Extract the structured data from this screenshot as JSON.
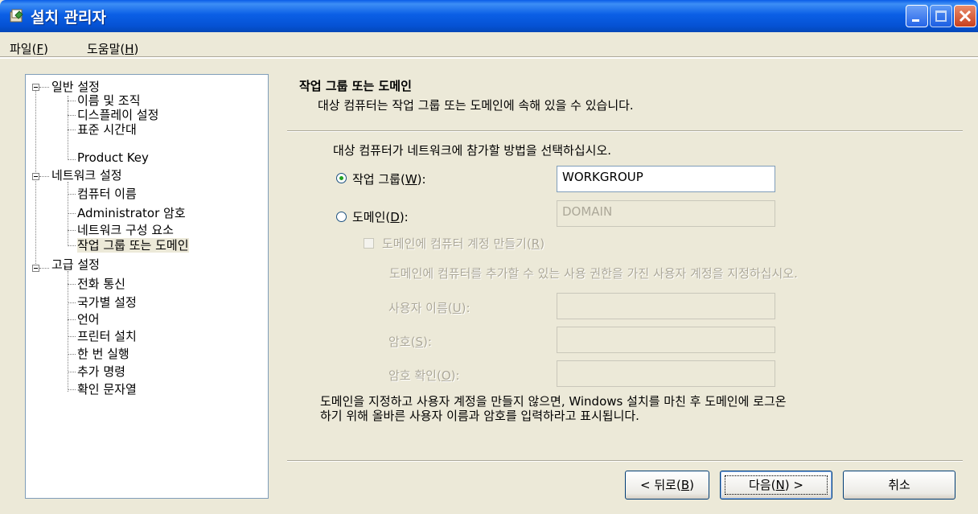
{
  "window": {
    "title": "설치 관리자",
    "icon": "setup-manager-icon"
  },
  "menu": [
    {
      "label": "파일(",
      "key": "F",
      "suffix": ")"
    },
    {
      "label": "도움말(",
      "key": "H",
      "suffix": ")"
    }
  ],
  "tree": {
    "groups": [
      {
        "label": "일반 설정",
        "children": [
          "이름 및 조직",
          "디스플레이 설정",
          "표준 시간대",
          "Product Key"
        ]
      },
      {
        "label": "네트워크 설정",
        "children": [
          "컴퓨터 이름",
          "Administrator 암호",
          "네트워크 구성 요소",
          "작업 그룹 또는 도메인"
        ]
      },
      {
        "label": "고급 설정",
        "children": [
          "전화 통신",
          "국가별 설정",
          "언어",
          "프린터 설치",
          "한 번 실행",
          "추가 명령",
          "확인 문자열"
        ]
      }
    ],
    "selected": "작업 그룹 또는 도메인"
  },
  "page": {
    "heading": "작업 그룹 또는 도메인",
    "subheading": "대상 컴퓨터는 작업 그룹 또는 도메인에 속해 있을 수 있습니다.",
    "prompt": "대상 컴퓨터가 네트워크에 참가할 방법을 선택하십시오.",
    "workgroup": {
      "label": "작업 그룹(",
      "key": "W",
      "suffix": "):",
      "value": "WORKGROUP",
      "selected": true
    },
    "domain": {
      "label": "도메인(",
      "key": "D",
      "suffix": "):",
      "value": "DOMAIN",
      "selected": false
    },
    "create_account": {
      "label": "도메인에 컴퓨터 계정 만들기(",
      "key": "R",
      "suffix": ")",
      "checked": false
    },
    "account_hint": "도메인에 컴퓨터를 추가할 수 있는 사용 권한을 가진 사용자 계정을 지정하십시오.",
    "username": {
      "label": "사용자 이름(",
      "key": "U",
      "suffix": "):",
      "value": ""
    },
    "password": {
      "label": "암호(",
      "key": "S",
      "suffix": "):",
      "value": ""
    },
    "confirm": {
      "label": "암호 확인(",
      "key": "O",
      "suffix": "):",
      "value": ""
    },
    "note_line1": "도메인을 지정하고 사용자 계정을 만들지 않으면, Windows 설치를 마친 후 도메인에 로그온",
    "note_line2": "하기 위해 올바른 사용자 이름과 암호를 입력하라고 표시됩니다."
  },
  "buttons": {
    "back": {
      "label": "< 뒤로(",
      "key": "B",
      "suffix": ")"
    },
    "next": {
      "label": "다음(",
      "key": "N",
      "suffix": ") >"
    },
    "cancel": {
      "label": "취소"
    }
  },
  "colors": {
    "titlebar": "#0A5CE8",
    "face": "#ECE9D8",
    "disabled_text": "#ACA899"
  }
}
